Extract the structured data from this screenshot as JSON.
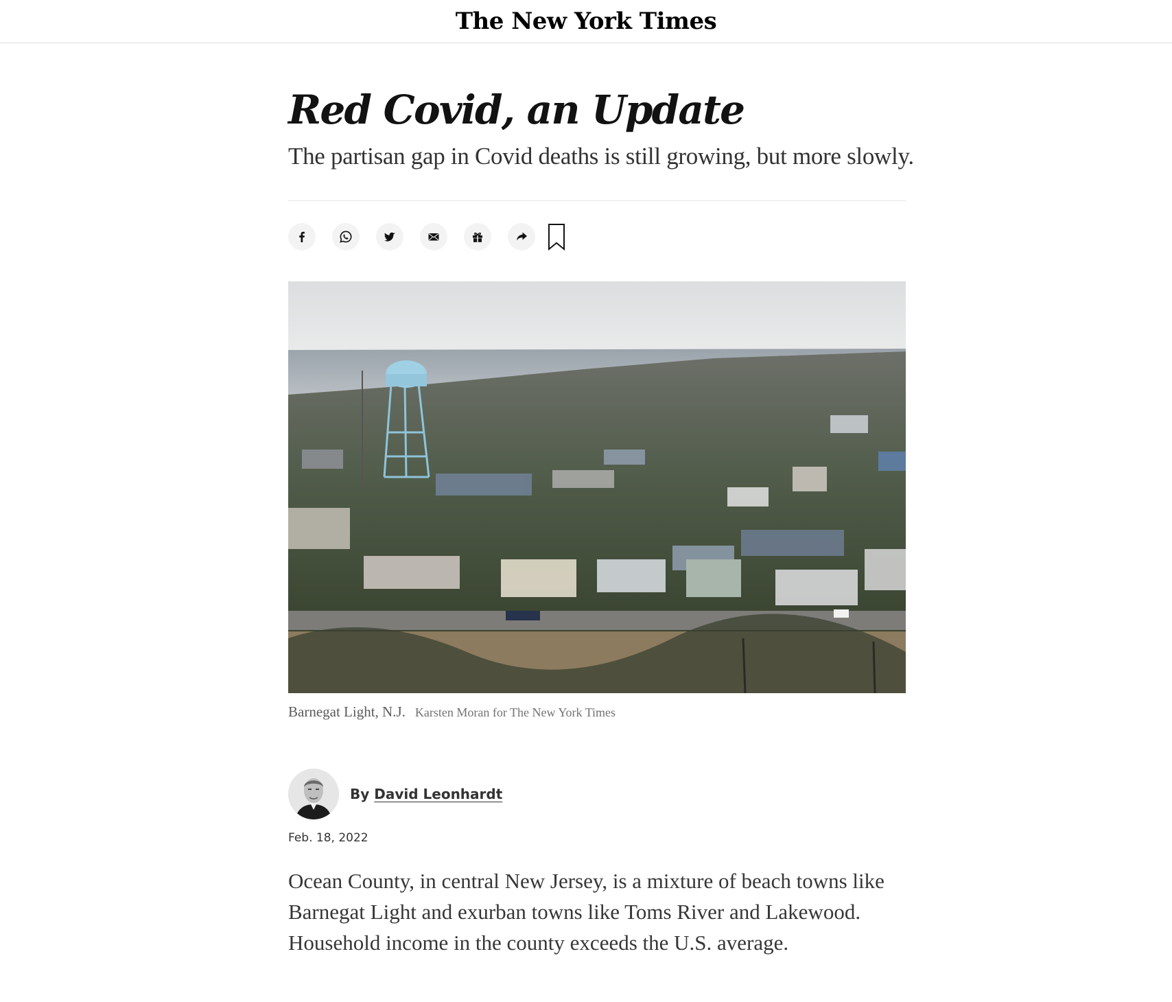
{
  "masthead": {
    "logo_text": "The New York Times"
  },
  "article": {
    "headline": "Red Covid, an Update",
    "summary": "The partisan gap in Covid deaths is still growing, but more slowly.",
    "share_buttons": [
      {
        "icon": "facebook-icon"
      },
      {
        "icon": "whatsapp-icon"
      },
      {
        "icon": "twitter-icon"
      },
      {
        "icon": "email-icon"
      },
      {
        "icon": "gift-icon"
      },
      {
        "icon": "share-arrow-icon"
      },
      {
        "icon": "bookmark-icon"
      }
    ],
    "photo": {
      "caption": "Barnegat Light, N.J.",
      "credit": "Karsten Moran for The New York Times"
    },
    "byline": {
      "prefix": "By",
      "author": "David Leonhardt"
    },
    "date": "Feb. 18, 2022",
    "first_paragraph": "Ocean County, in central New Jersey, is a mixture of beach towns like Barnegat Light and exurban towns like Toms River and Lakewood. Household income in the county exceeds the U.S. average."
  },
  "colors": {
    "text": "#121212",
    "rule": "#e2e2e2",
    "button_bg": "#f3f3f3"
  }
}
